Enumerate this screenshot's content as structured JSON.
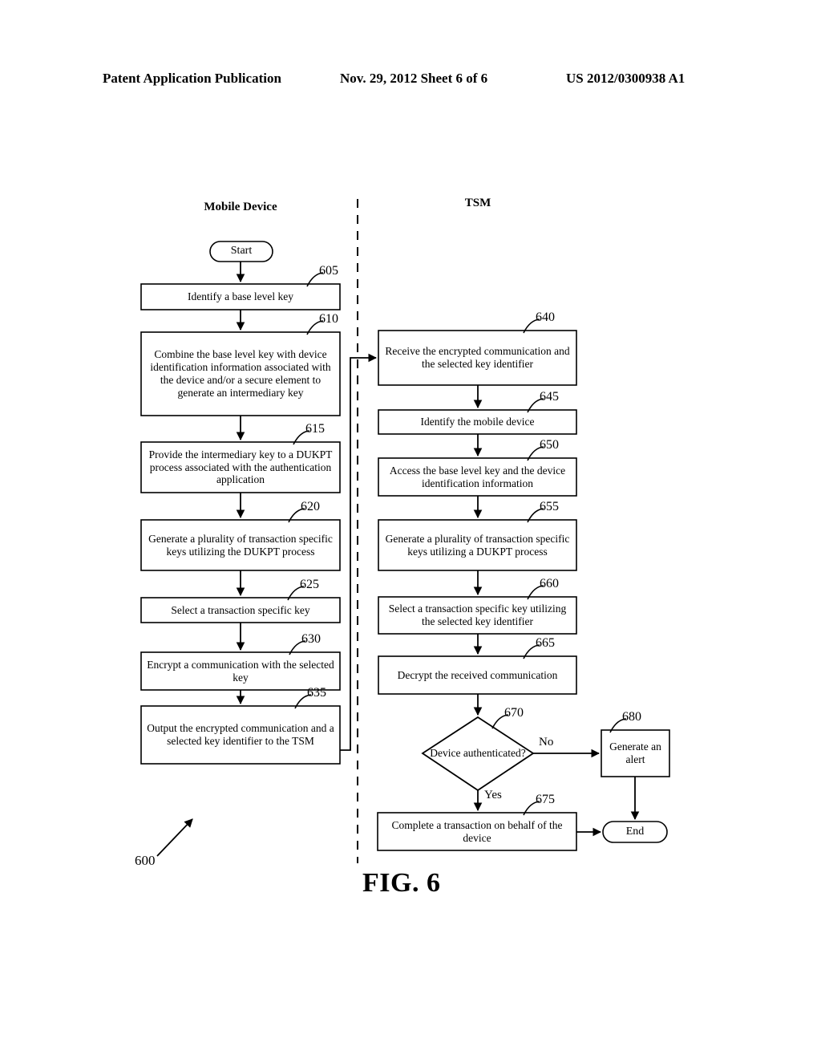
{
  "header": {
    "left": "Patent Application Publication",
    "center": "Nov. 29, 2012  Sheet 6 of 6",
    "right": "US 2012/0300938 A1"
  },
  "lanes": {
    "left_title": "Mobile Device",
    "right_title": "TSM"
  },
  "figure": {
    "caption": "FIG. 6",
    "ref": "600"
  },
  "edge_labels": {
    "no": "No",
    "yes": "Yes"
  },
  "terminators": {
    "start": "Start",
    "end": "End"
  },
  "nodes": [
    {
      "ref": "605",
      "text": "Identify a base level key"
    },
    {
      "ref": "610",
      "text": "Combine the base level key with device identification information associated with the device and/or a secure element to generate an intermediary key"
    },
    {
      "ref": "615",
      "text": "Provide the intermediary key to a DUKPT process associated with the authentication application"
    },
    {
      "ref": "620",
      "text": "Generate a plurality of transaction specific keys utilizing the DUKPT process"
    },
    {
      "ref": "625",
      "text": "Select a transaction specific key"
    },
    {
      "ref": "630",
      "text": "Encrypt a communication with the selected key"
    },
    {
      "ref": "635",
      "text": "Output the encrypted communication and a selected key identifier to the TSM"
    },
    {
      "ref": "640",
      "text": "Receive the encrypted communication and the selected key identifier"
    },
    {
      "ref": "645",
      "text": "Identify the mobile device"
    },
    {
      "ref": "650",
      "text": "Access the base level key and the device identification information"
    },
    {
      "ref": "655",
      "text": "Generate a plurality of transaction specific keys utilizing a DUKPT process"
    },
    {
      "ref": "660",
      "text": "Select a transaction specific key utilizing the selected key identifier"
    },
    {
      "ref": "665",
      "text": "Decrypt the received communication"
    },
    {
      "ref": "670",
      "text": "Device authenticated?"
    },
    {
      "ref": "675",
      "text": "Complete a transaction on behalf of the device"
    },
    {
      "ref": "680",
      "text": "Generate an alert"
    }
  ],
  "colors": {
    "ink": "#000000",
    "paper": "#ffffff"
  }
}
